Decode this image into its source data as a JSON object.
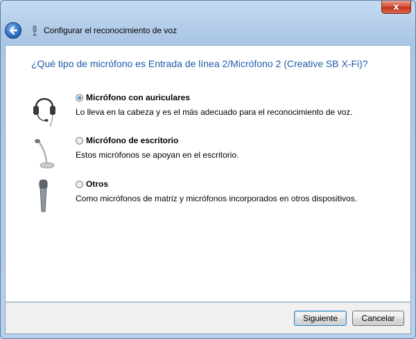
{
  "window": {
    "close_glyph": "x",
    "title": "Configurar el reconocimiento de voz"
  },
  "question": "¿Qué tipo de micrófono es Entrada de línea 2/Micrófono 2 (Creative SB X-Fi)?",
  "options": [
    {
      "label": "Micrófono con auriculares",
      "description": "Lo lleva en la cabeza y es el más adecuado para el reconocimiento de voz.",
      "selected": true,
      "icon": "headset-microphone-icon"
    },
    {
      "label": "Micrófono de escritorio",
      "description": "Estos micrófonos se apoyan en el escritorio.",
      "selected": false,
      "icon": "desktop-microphone-icon"
    },
    {
      "label": "Otros",
      "description": "Como micrófonos de matriz y micrófonos incorporados en otros dispositivos.",
      "selected": false,
      "icon": "handheld-microphone-icon"
    }
  ],
  "buttons": {
    "next": "Siguiente",
    "cancel": "Cancelar"
  },
  "colors": {
    "question_text": "#1e5aa8",
    "close_button": "#c7331a",
    "back_button": "#2f6fc4"
  }
}
